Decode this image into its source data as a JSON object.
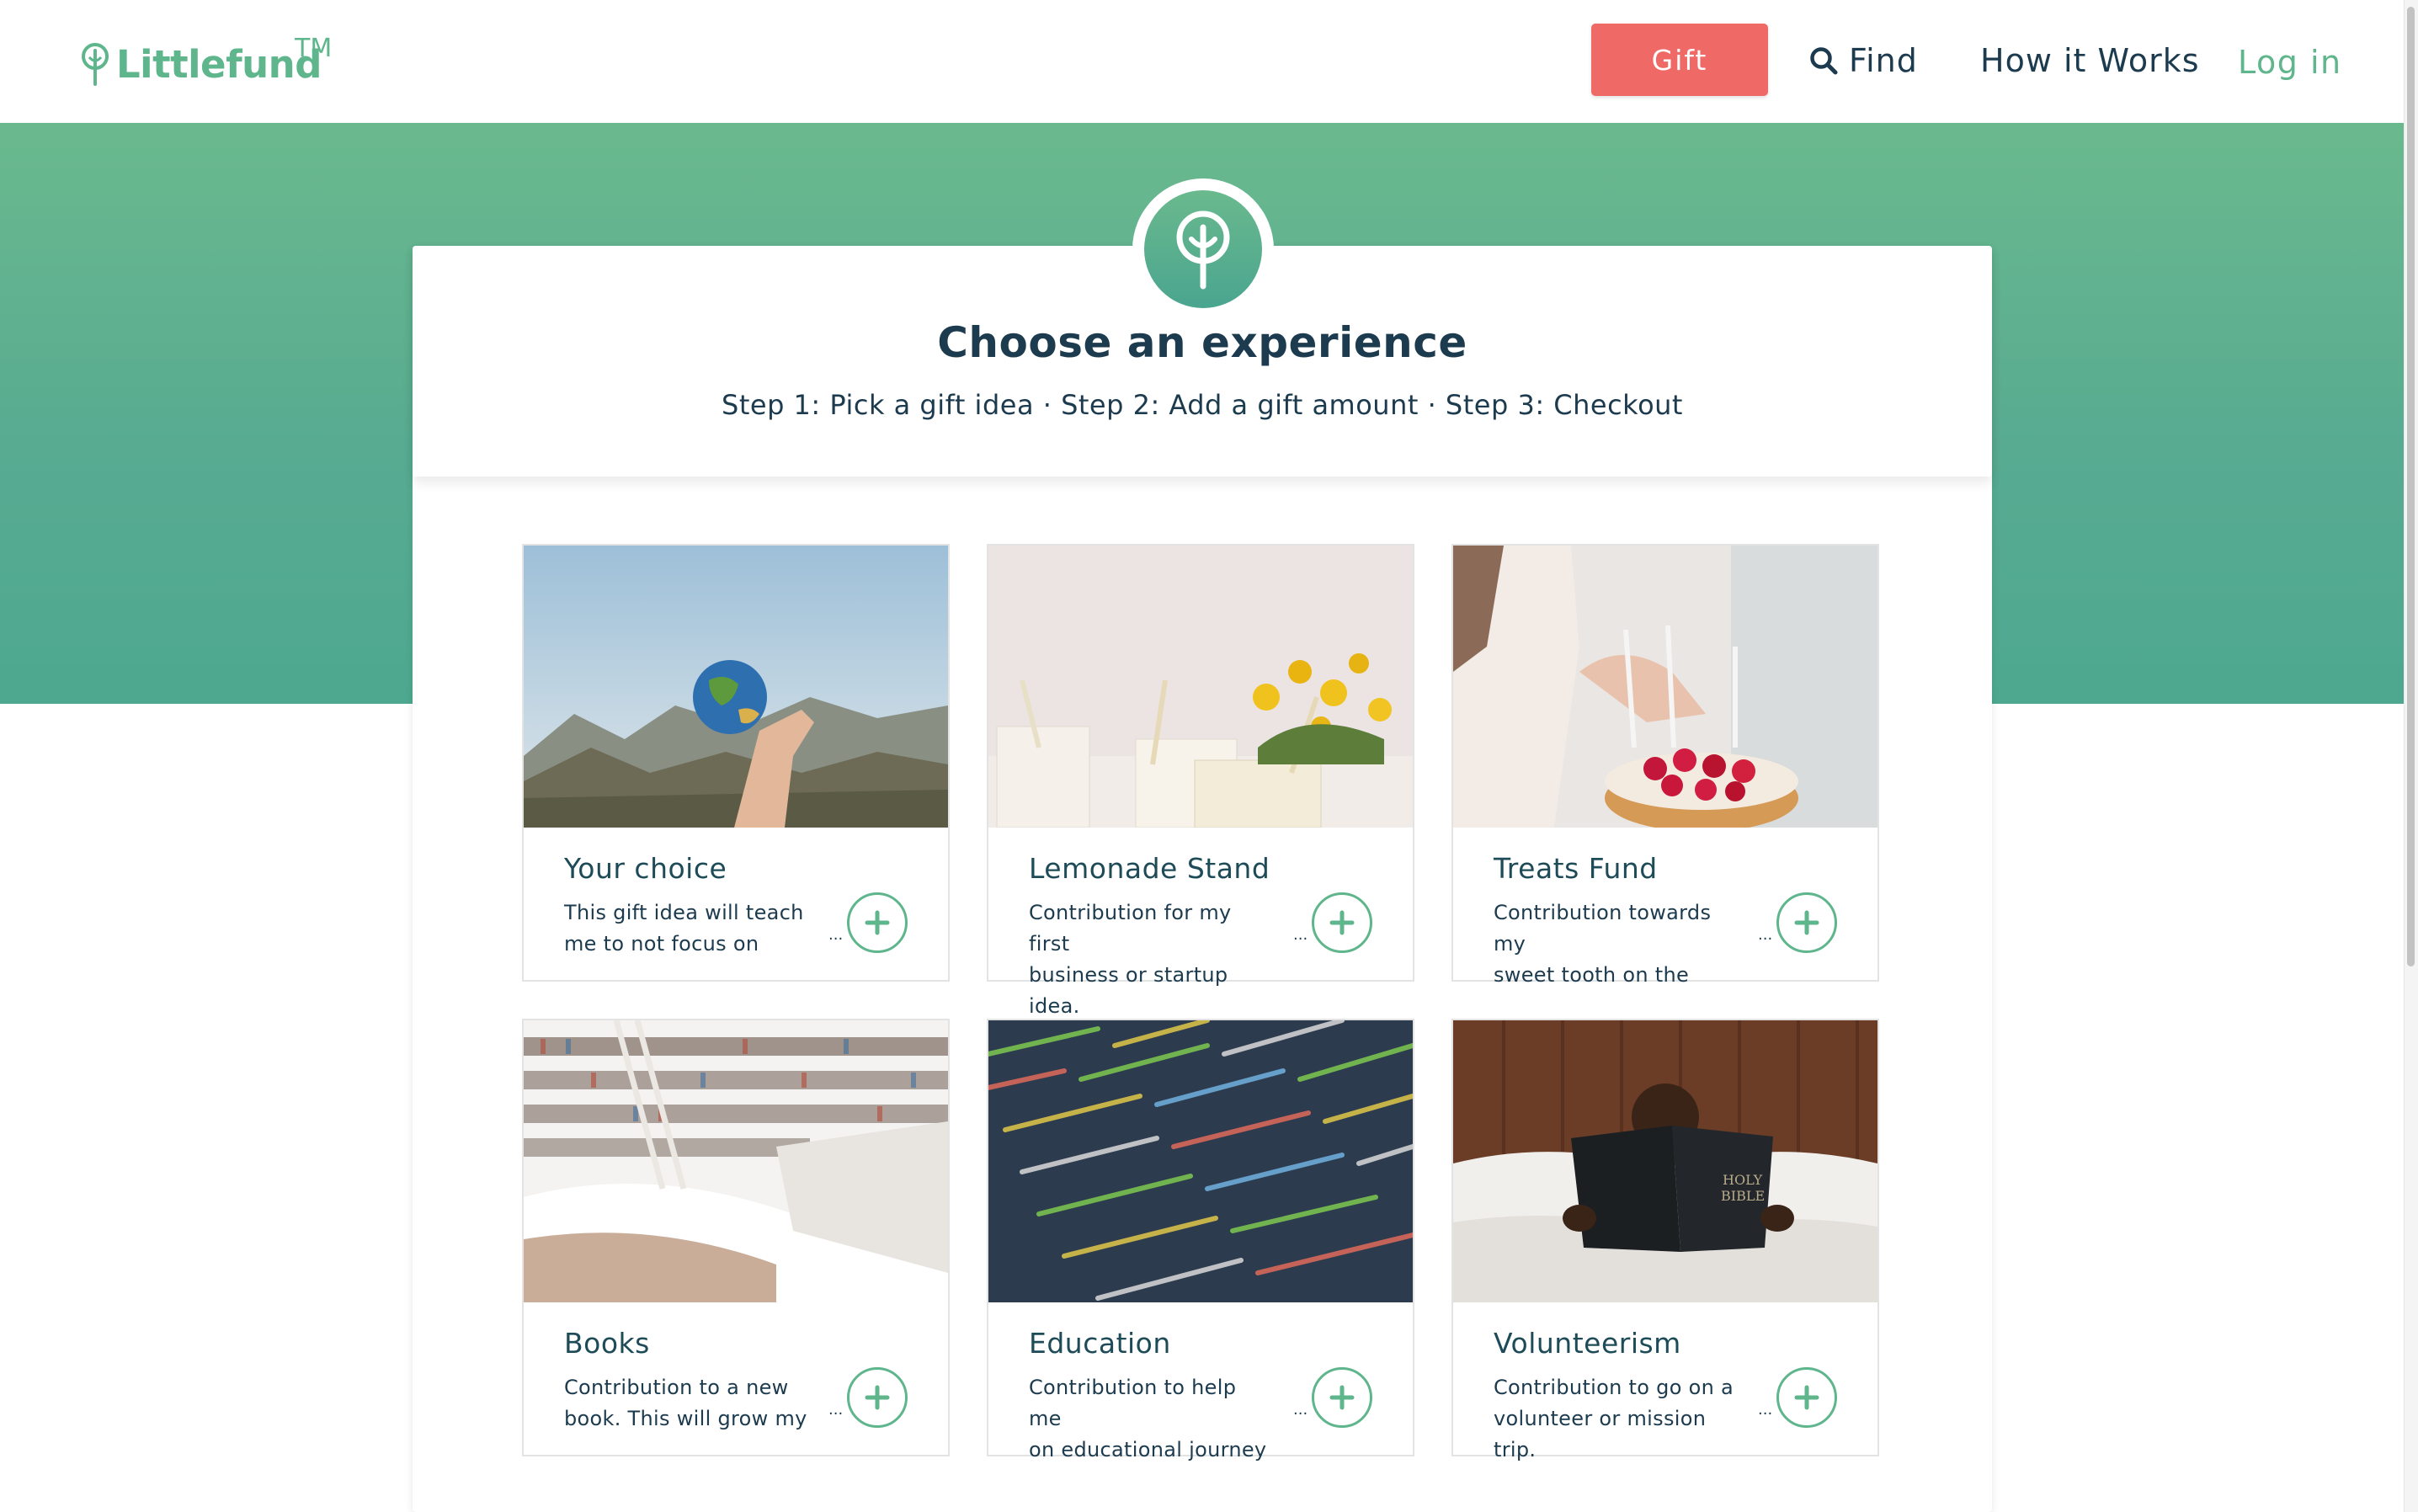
{
  "brand": {
    "name": "Littlefund",
    "trademark": "TM",
    "logo_icon": "tree-icon",
    "color": "#5fb58c"
  },
  "nav": {
    "gift_label": "Gift",
    "gift_color": "#ef6a66",
    "find_label": "Find",
    "find_icon": "search-icon",
    "how_label": "How it Works",
    "login_label": "Log in"
  },
  "header": {
    "badge_icon": "tree-icon",
    "title": "Choose an experience",
    "subtitle": "Step 1: Pick a gift idea · Step 2: Add a gift amount · Step 3: Checkout"
  },
  "cards": [
    {
      "title": "Your choice",
      "desc_line1": "This gift idea will teach",
      "desc_line2": "me to not focus on",
      "ellipsis": "...",
      "image": "hand-holding-globe-photo",
      "add_icon": "plus-icon"
    },
    {
      "title": "Lemonade Stand",
      "desc_line1": "Contribution for my first",
      "desc_line2": "business or startup idea.",
      "ellipsis": "...",
      "image": "lemonade-glasses-flowers-photo",
      "add_icon": "plus-icon"
    },
    {
      "title": "Treats Fund",
      "desc_line1": "Contribution towards my",
      "desc_line2": "sweet tooth on the",
      "ellipsis": "...",
      "image": "raspberry-cake-candles-photo",
      "add_icon": "plus-icon"
    },
    {
      "title": "Books",
      "desc_line1": "Contribution to a new",
      "desc_line2": "book. This will grow my",
      "ellipsis": "...",
      "image": "library-bookshelves-photo",
      "add_icon": "plus-icon"
    },
    {
      "title": "Education",
      "desc_line1": "Contribution to help me",
      "desc_line2": "on educational journey",
      "ellipsis": "...",
      "image": "code-on-screen-photo",
      "add_icon": "plus-icon"
    },
    {
      "title": "Volunteerism",
      "desc_line1": "Contribution to go on a",
      "desc_line2": "volunteer or mission trip.",
      "ellipsis": "...",
      "image": "child-reading-bible-photo",
      "add_icon": "plus-icon"
    }
  ]
}
